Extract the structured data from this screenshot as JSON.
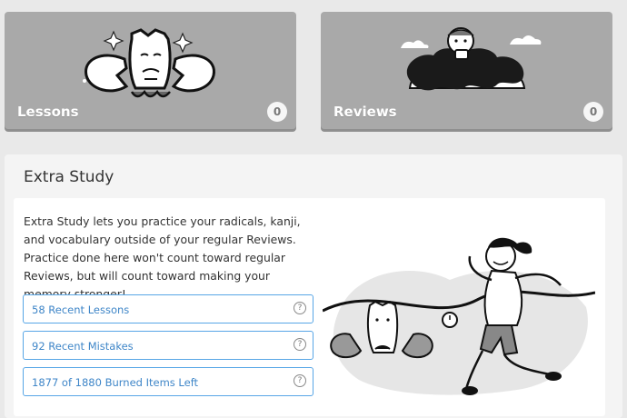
{
  "tiles": {
    "lessons": {
      "label": "Lessons",
      "count": "0"
    },
    "reviews": {
      "label": "Reviews",
      "count": "0"
    }
  },
  "extra_study": {
    "title": "Extra Study",
    "description": "Extra Study lets you practice your radicals, kanji, and vocabulary outside of your regular Reviews. Practice done here won't count toward regular Reviews, but will count toward making your memory stronger!",
    "buttons": [
      {
        "label": "58 Recent Lessons",
        "help": "?"
      },
      {
        "label": "92 Recent Mistakes",
        "help": "?"
      },
      {
        "label": "1877 of 1880 Burned Items Left",
        "help": "?"
      }
    ]
  },
  "colors": {
    "tile_bg": "#a9a9a9",
    "button_border": "#58a6e6",
    "button_text": "#3f86c8"
  }
}
